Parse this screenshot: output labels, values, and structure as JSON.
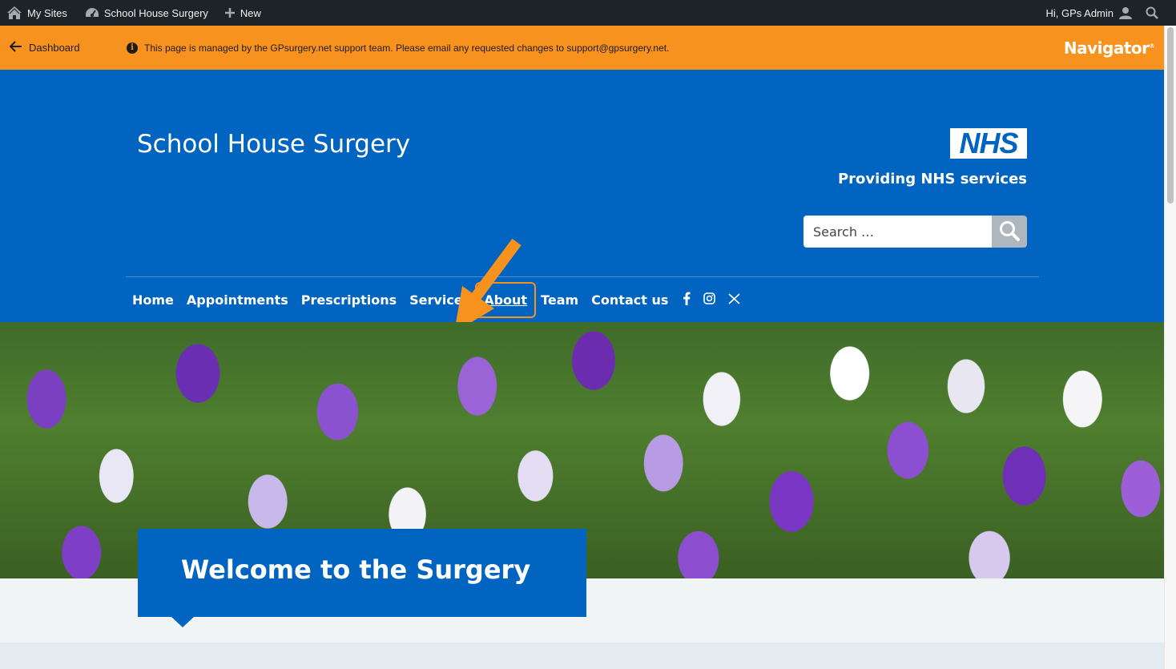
{
  "admin_bar": {
    "my_sites": "My Sites",
    "site_name": "School House Surgery",
    "new": "New",
    "greeting": "Hi, GPs Admin"
  },
  "navigator_bar": {
    "dashboard": "Dashboard",
    "notice": "This page is managed by the GPsurgery.net support team. Please email any requested changes to support@gpsurgery.net.",
    "logo": "Navigator",
    "logo_mark": "®"
  },
  "header": {
    "site_title": "School House Surgery",
    "nhs_logo": "NHS",
    "nhs_tagline": "Providing NHS services",
    "search_placeholder": "Search …"
  },
  "menu": {
    "items": [
      "Home",
      "Appointments",
      "Prescriptions",
      "Services",
      "About",
      "Team",
      "Contact us"
    ],
    "highlighted": "About"
  },
  "social": [
    "facebook-icon",
    "instagram-icon",
    "x-icon"
  ],
  "hero": {
    "welcome_title": "Welcome to the Surgery"
  },
  "colors": {
    "nhs_blue": "#0064c0",
    "navigator_orange": "#f7921e",
    "admin_bar": "#1d2327"
  }
}
